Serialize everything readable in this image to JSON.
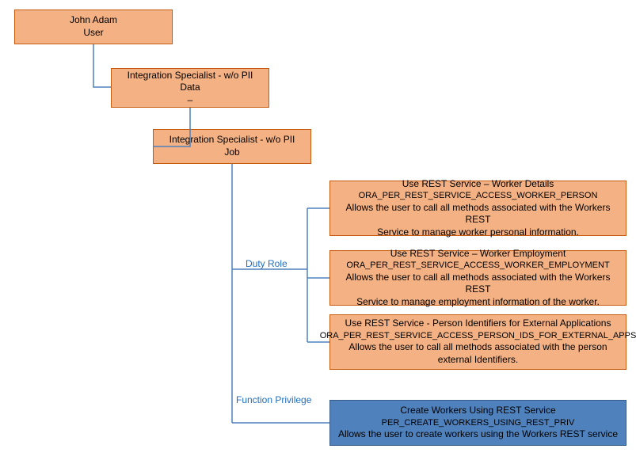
{
  "user_box": {
    "name": "John Adam",
    "type": "User"
  },
  "data_box": {
    "name": "Integration Specialist - w/o PII",
    "type": "Data",
    "sub": "–"
  },
  "job_box": {
    "name": "Integration Specialist - w/o PII",
    "type": "Job"
  },
  "labels": {
    "duty_role": "Duty Role",
    "function_priv": "Function Privilege"
  },
  "duties": {
    "d1": {
      "title": "Use REST Service – Worker Details",
      "code": "ORA_PER_REST_SERVICE_ACCESS_WORKER_PERSON",
      "desc1": "Allows the user to call all methods associated with the Workers REST",
      "desc2": "Service to manage worker personal information."
    },
    "d2": {
      "title": "Use REST Service – Worker Employment",
      "code": "ORA_PER_REST_SERVICE_ACCESS_WORKER_EMPLOYMENT",
      "desc1": "Allows the user to call all methods associated with the Workers REST",
      "desc2": "Service to manage employment information of the worker."
    },
    "d3": {
      "title": "Use REST Service - Person Identifiers for External Applications",
      "code": "ORA_PER_REST_SERVICE_ACCESS_PERSON_IDS_FOR_EXTERNAL_APPS",
      "desc1": "Allows the user to call all methods associated with the person",
      "desc2": "external Identifiers."
    }
  },
  "priv": {
    "title": "Create Workers Using REST Service",
    "code": "PER_CREATE_WORKERS_USING_REST_PRIV",
    "desc": "Allows the user to create workers using the Workers REST service"
  }
}
